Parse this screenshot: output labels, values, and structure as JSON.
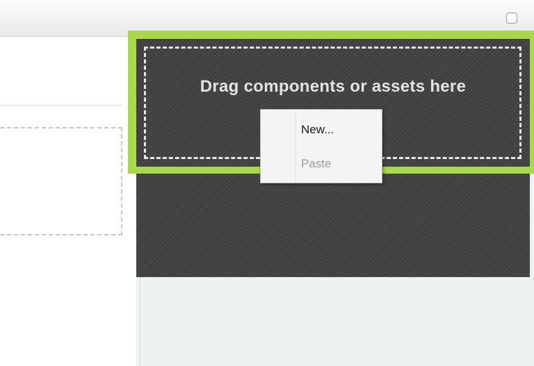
{
  "drop_zone": {
    "label": "Drag components or assets here"
  },
  "context_menu": {
    "items": [
      {
        "label": "New...",
        "enabled": true
      },
      {
        "label": "Paste",
        "enabled": false
      }
    ]
  },
  "colors": {
    "drop_zone_border": "#a7d94b",
    "dark_panel": "#444444",
    "right_column_bg": "#eef1f2"
  }
}
